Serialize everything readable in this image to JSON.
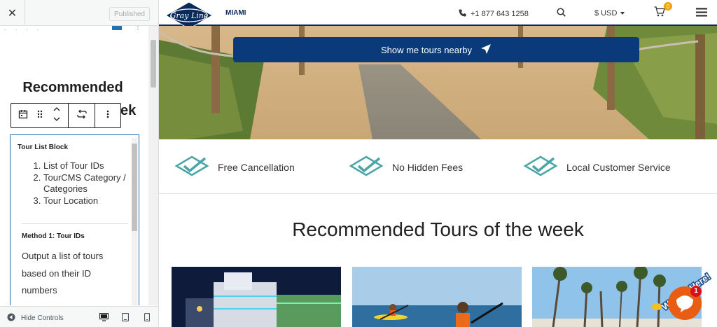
{
  "panel": {
    "publish_label": "Published",
    "block_heading": "Recommended",
    "block_heading_tail": "ek",
    "tour_list": {
      "heading": "Tour List Block",
      "items": [
        "List of Tour IDs",
        "TourCMS Category / Categories",
        "Tour Location"
      ],
      "method_heading": "Method 1: Tour IDs",
      "description": "Output a list of tours based on their ID numbers"
    },
    "footer": {
      "hide_controls_label": "Hide Controls"
    }
  },
  "site": {
    "city": "MIAMI",
    "phone": "+1 877 643 1258",
    "currency": "$ USD",
    "cart_count": "0",
    "logo_text": "Gray Line",
    "hero_button": "Show me tours nearby",
    "features": [
      "Free Cancellation",
      "No Hidden Fees",
      "Local Customer Service"
    ],
    "section_title": "Recommended Tours of the week",
    "chat": {
      "label": "We Are Here!",
      "badge": "1"
    }
  },
  "colors": {
    "brand_navy": "#0b2a5c",
    "button_blue": "#0b3a7a",
    "teal_check": "#4aa5a8",
    "chat_orange": "#e85d12",
    "cart_badge": "#f4a300"
  }
}
